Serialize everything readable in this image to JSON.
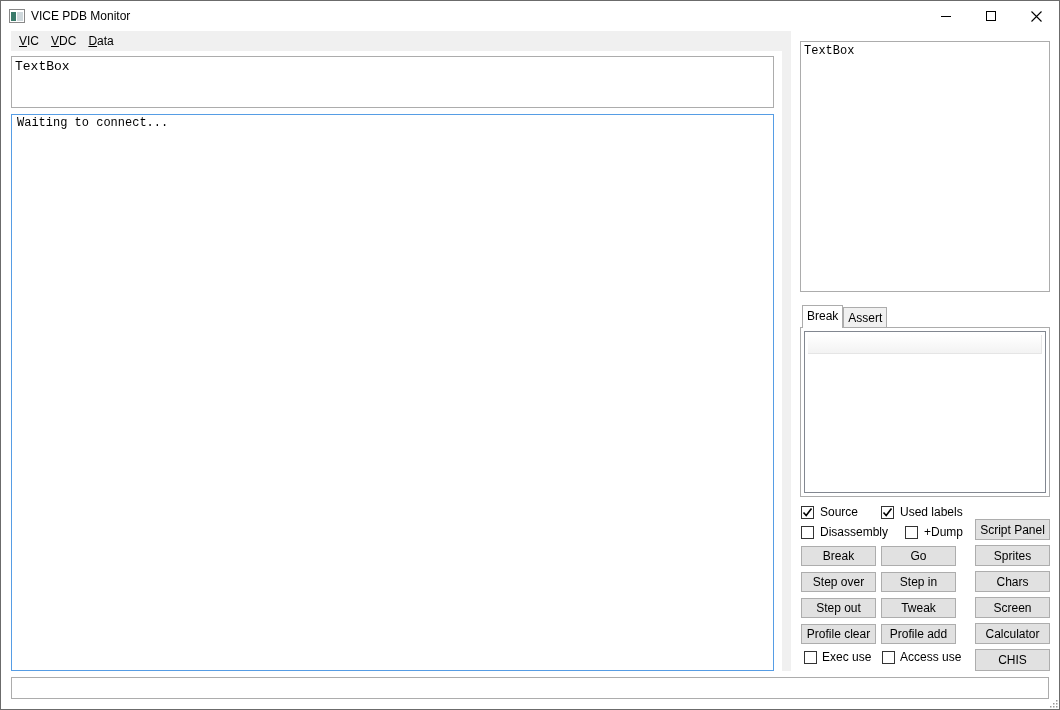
{
  "window": {
    "title": "VICE PDB Monitor"
  },
  "menu": [
    {
      "label": "VIC"
    },
    {
      "label": "VDC"
    },
    {
      "label": "Data"
    }
  ],
  "command_box": {
    "value": "TextBox"
  },
  "output": {
    "value": "Waiting to connect..."
  },
  "side_text": {
    "value": "TextBox"
  },
  "tabs": [
    {
      "label": "Break",
      "selected": true
    },
    {
      "label": "Assert",
      "selected": false
    }
  ],
  "options": [
    {
      "label": "Source",
      "checked": true
    },
    {
      "label": "Used labels",
      "checked": true
    },
    {
      "label": "Disassembly",
      "checked": false
    },
    {
      "label": "+Dump",
      "checked": false
    }
  ],
  "actions": [
    {
      "label": "Break"
    },
    {
      "label": "Go"
    },
    {
      "label": "Step over"
    },
    {
      "label": "Step in"
    },
    {
      "label": "Step out"
    },
    {
      "label": "Tweak"
    },
    {
      "label": "Profile clear"
    },
    {
      "label": "Profile add"
    }
  ],
  "use_options": [
    {
      "label": "Exec use",
      "checked": false
    },
    {
      "label": "Access use",
      "checked": false
    }
  ],
  "panels": [
    {
      "label": "Script Panel"
    },
    {
      "label": "Sprites"
    },
    {
      "label": "Chars"
    },
    {
      "label": "Screen"
    },
    {
      "label": "Calculator"
    },
    {
      "label": "CHIS"
    }
  ]
}
